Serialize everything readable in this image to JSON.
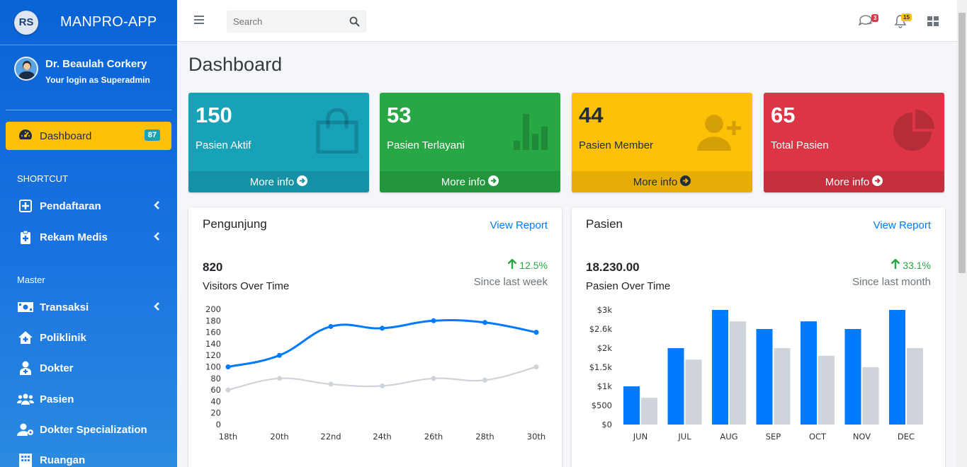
{
  "app": {
    "logo": "RS",
    "name": "MANPRO-APP"
  },
  "user": {
    "name": "Dr. Beaulah Corkery",
    "role": "Your login as Superadmin"
  },
  "sidebar": {
    "active": {
      "label": "Dashboard",
      "badge": "87",
      "icon": "tachometer-icon"
    },
    "header_shortcut": "SHORTCUT",
    "shortcut": [
      {
        "label": "Pendaftaran",
        "icon": "plus-square-icon"
      },
      {
        "label": "Rekam Medis",
        "icon": "clipboard-medical-icon"
      }
    ],
    "header_master": "Master",
    "master": [
      {
        "label": "Transaksi",
        "icon": "money-bill-icon"
      },
      {
        "label": "Poliklinik",
        "icon": "clinic-icon"
      },
      {
        "label": "Dokter",
        "icon": "doctor-icon"
      },
      {
        "label": "Pasien",
        "icon": "users-icon"
      },
      {
        "label": "Dokter Specialization",
        "icon": "user-cog-icon"
      },
      {
        "label": "Ruangan",
        "icon": "building-icon"
      }
    ]
  },
  "topbar": {
    "search_placeholder": "Search",
    "messages_badge": "3",
    "notifications_badge": "15"
  },
  "page": {
    "title": "Dashboard"
  },
  "boxes": [
    {
      "value": "150",
      "label": "Pasien Aktif",
      "more": "More info",
      "color": "#17a2b8",
      "icon": "shopping-bag-icon"
    },
    {
      "value": "53",
      "label": "Pasien Terlayani",
      "more": "More info",
      "color": "#28a745",
      "icon": "bar-chart-icon"
    },
    {
      "value": "44",
      "label": "Pasien Member",
      "more": "More info",
      "color": "#ffc107",
      "icon": "user-plus-icon"
    },
    {
      "value": "65",
      "label": "Total Pasien",
      "more": "More info",
      "color": "#dc3545",
      "icon": "pie-chart-icon"
    }
  ],
  "cards": {
    "visitors": {
      "title": "Pengunjung",
      "link": "View Report",
      "value": "820",
      "subtitle": "Visitors Over Time",
      "change": "12.5%",
      "since": "Since last week"
    },
    "patients": {
      "title": "Pasien",
      "link": "View Report",
      "value": "18.230.00",
      "subtitle": "Pasien Over Time",
      "change": "33.1%",
      "since": "Since last month"
    }
  },
  "chart_data": [
    {
      "type": "line",
      "categories": [
        "18th",
        "20th",
        "22nd",
        "24th",
        "26th",
        "28th",
        "30th"
      ],
      "series": [
        {
          "values": [
            100,
            120,
            170,
            167,
            180,
            177,
            160
          ],
          "color": "#007bff"
        },
        {
          "values": [
            60,
            80,
            70,
            67,
            80,
            77,
            100
          ],
          "color": "#ced4da"
        }
      ],
      "ylim": [
        0,
        200
      ],
      "yticks": [
        "0",
        "20",
        "40",
        "60",
        "80",
        "100",
        "120",
        "140",
        "160",
        "180",
        "200"
      ]
    },
    {
      "type": "bar",
      "categories": [
        "JUN",
        "JUL",
        "AUG",
        "SEP",
        "OCT",
        "NOV",
        "DEC"
      ],
      "series": [
        {
          "values": [
            1000,
            2000,
            3000,
            2500,
            2700,
            2500,
            3000
          ],
          "color": "#007bff"
        },
        {
          "values": [
            700,
            1700,
            2700,
            2000,
            1800,
            1500,
            2000
          ],
          "color": "#ced4da"
        }
      ],
      "ylim": [
        0,
        3000
      ],
      "yticks": [
        "$0",
        "$500",
        "$1k",
        "$1.5k",
        "$2k",
        "$2.6k",
        "$3k"
      ]
    }
  ]
}
